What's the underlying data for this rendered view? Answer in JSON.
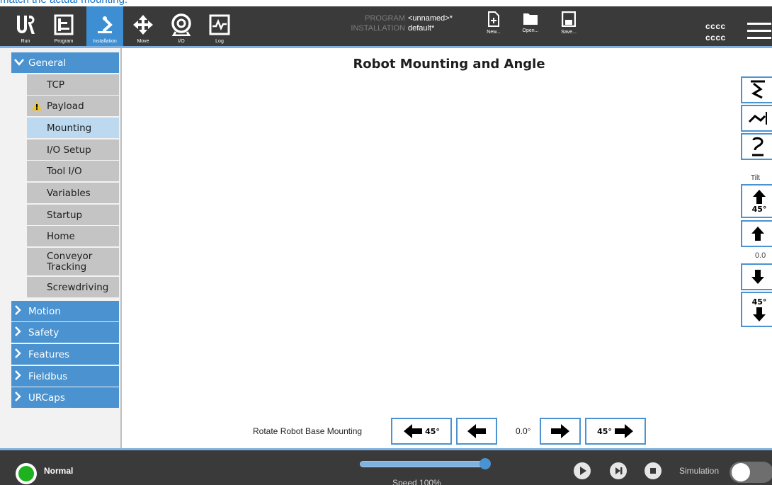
{
  "top_fragment": "match the actual mounting.",
  "header": {
    "nav": [
      {
        "label": "Run"
      },
      {
        "label": "Program"
      },
      {
        "label": "Installation"
      },
      {
        "label": "Move"
      },
      {
        "label": "I/O"
      },
      {
        "label": "Log"
      }
    ],
    "program_key": "PROGRAM",
    "program_value": "<unnamed>*",
    "installation_key": "INSTALLATION",
    "installation_value": "default*",
    "file_buttons": [
      {
        "label": "New..."
      },
      {
        "label": "Open..."
      },
      {
        "label": "Save..."
      }
    ],
    "robot_name_1": "cccc",
    "robot_name_2": "cccc"
  },
  "sidebar": {
    "general": "General",
    "general_items": [
      {
        "label": "TCP"
      },
      {
        "label": "Payload"
      },
      {
        "label": "Mounting"
      },
      {
        "label": "I/O Setup"
      },
      {
        "label": "Tool I/O"
      },
      {
        "label": "Variables"
      },
      {
        "label": "Startup"
      },
      {
        "label": "Home"
      },
      {
        "label": "Conveyor Tracking"
      },
      {
        "label": "Screwdriving"
      }
    ],
    "categories": [
      {
        "label": "Motion"
      },
      {
        "label": "Safety"
      },
      {
        "label": "Features"
      },
      {
        "label": "Fieldbus"
      },
      {
        "label": "URCaps"
      }
    ]
  },
  "main": {
    "title": "Robot Mounting and Angle",
    "tilt_label": "Tilt",
    "tilt_up_45": "45°",
    "tilt_value": "0.0",
    "tilt_down_45": "45°",
    "rotate_label": "Rotate Robot Base Mounting",
    "rotate_left_45": "45°",
    "rotate_value": "0.0°",
    "rotate_right_45": "45°"
  },
  "footer": {
    "status": "Normal",
    "speed": "Speed 100%",
    "speed_fraction": 1.0,
    "simulation": "Simulation"
  },
  "colors": {
    "accent": "#4a92d0",
    "header_bg": "#3a3a3a",
    "status_ok": "#1fb21f"
  }
}
